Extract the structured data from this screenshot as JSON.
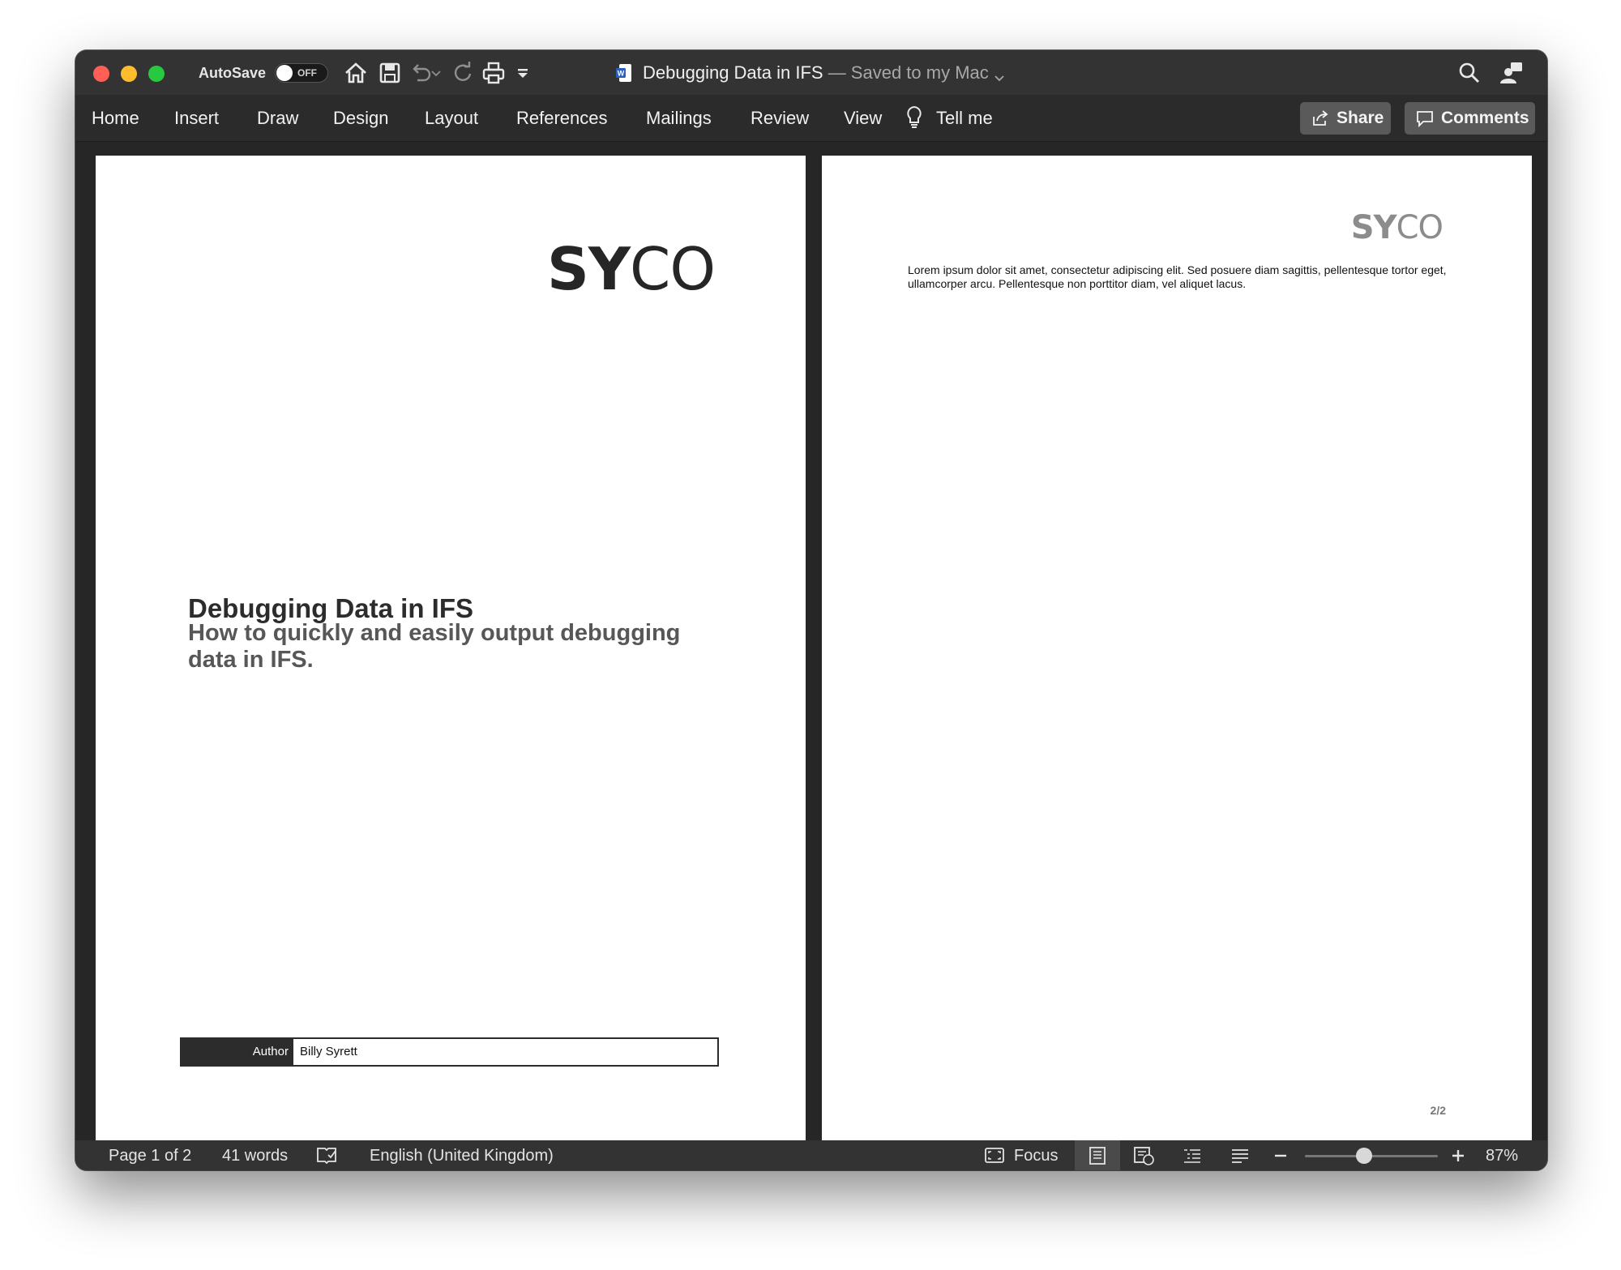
{
  "titlebar": {
    "autosave_label": "AutoSave",
    "autosave_state": "OFF",
    "doc_name": "Debugging Data in IFS",
    "save_status": " — Saved to my Mac",
    "icons": [
      "home-icon",
      "save-icon",
      "undo-icon",
      "redo-icon",
      "print-icon",
      "customize-toolbar-icon",
      "search-icon",
      "share-person-icon"
    ]
  },
  "ribbon": {
    "tabs": [
      "Home",
      "Insert",
      "Draw",
      "Design",
      "Layout",
      "References",
      "Mailings",
      "Review",
      "View"
    ],
    "tell_me": "Tell me",
    "share_label": "Share",
    "comments_label": "Comments"
  },
  "page1": {
    "logo_bold": "SY",
    "logo_light": "CO",
    "title": "Debugging Data in IFS",
    "subtitle": "How to quickly and easily output debugging data in IFS.",
    "author_label": "Author",
    "author_name": "Billy Syrett"
  },
  "page2": {
    "logo_bold": "SY",
    "logo_light": "CO",
    "body": "Lorem ipsum dolor sit amet, consectetur adipiscing elit. Sed posuere diam sagittis, pellentesque tortor eget, ullamcorper arcu. Pellentesque non porttitor diam, vel aliquet lacus.",
    "page_number": "2/2"
  },
  "statusbar": {
    "page_info": "Page 1 of 2",
    "word_count": "41 words",
    "language": "English (United Kingdom)",
    "focus_label": "Focus",
    "zoom": "87%"
  }
}
